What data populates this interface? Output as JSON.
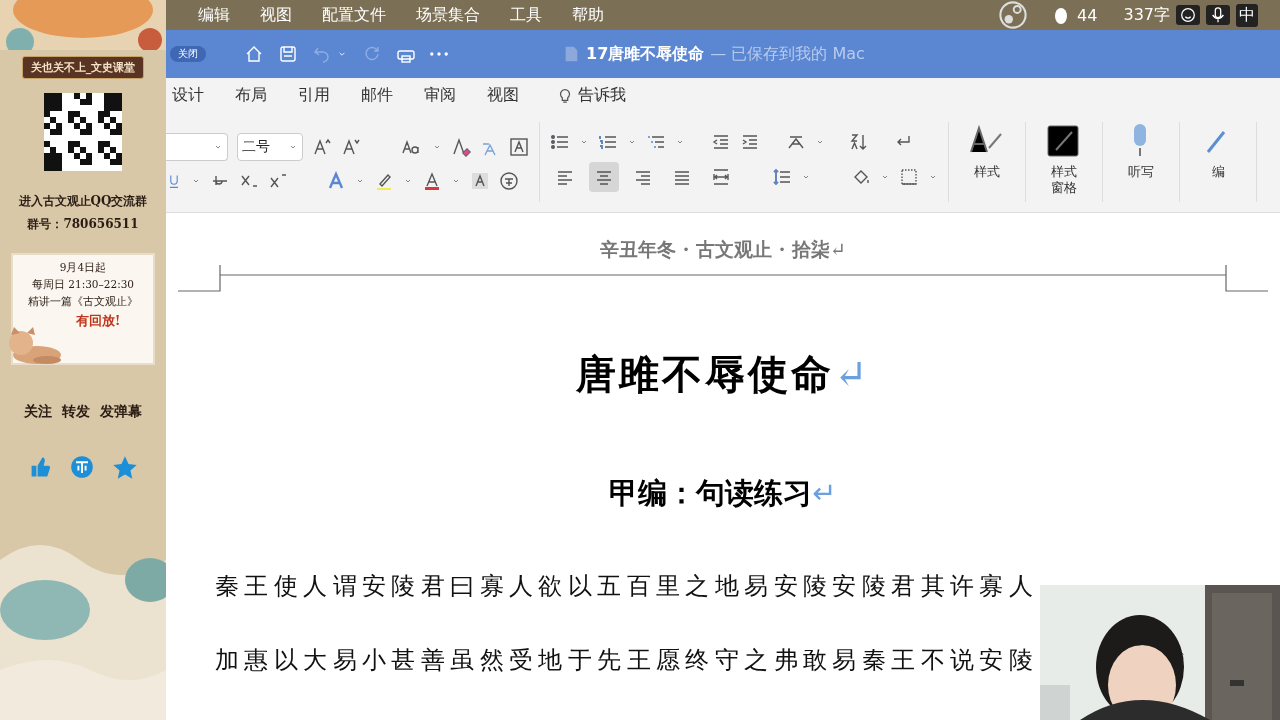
{
  "sidebar": {
    "channel_name": "关也关不上_文史课堂",
    "group_invite": "进入古文观止QQ交流群",
    "group_number": "群号：780656511",
    "schedule": {
      "lines": [
        "9月4日起",
        "每周日 21:30–22:30",
        "精讲一篇《古文观止》"
      ],
      "replay": "有回放!"
    },
    "actions": "关注  转发  发弹幕"
  },
  "menu_bar": {
    "items": [
      "编辑",
      "视图",
      "配置文件",
      "场景集合",
      "工具",
      "帮助"
    ],
    "notification_count": "44",
    "word_count": "337字",
    "input_method": "中"
  },
  "title_bar": {
    "close_label": "关闭",
    "doc_title": "17唐雎不辱使命",
    "save_status": "— 已保存到我的 Mac"
  },
  "ribbon_tabs": [
    {
      "label": "设计",
      "selected": false
    },
    {
      "label": "布局",
      "selected": false
    },
    {
      "label": "引用",
      "selected": false
    },
    {
      "label": "邮件",
      "selected": false
    },
    {
      "label": "审阅",
      "selected": false
    },
    {
      "label": "视图",
      "selected": false
    }
  ],
  "tell_me": "告诉我",
  "font_size": "二号",
  "alignment": [
    {
      "kind": "left",
      "selected": false
    },
    {
      "kind": "center",
      "selected": true
    },
    {
      "kind": "right",
      "selected": false
    },
    {
      "kind": "justify",
      "selected": false
    },
    {
      "kind": "distributed",
      "selected": false
    }
  ],
  "big_buttons": [
    {
      "kind": "styles",
      "label": "样式"
    },
    {
      "kind": "styles-pane",
      "label": "样式窗格"
    },
    {
      "kind": "dictate",
      "label": "听写"
    },
    {
      "kind": "edit",
      "label": "编"
    }
  ],
  "document": {
    "header": "辛丑年冬 · 古文观止 · 拾柒",
    "header_mark": "↵",
    "title": "唐雎不辱使命",
    "title_mark": "↵",
    "subtitle": "甲编：句读练习",
    "subtitle_mark": "↵",
    "lines": [
      "秦王使人谓安陵君曰寡人欲以五百里之地易安陵安陵君其许寡人",
      "加惠以大易小甚善虽然受地于先王愿终守之弗敢易秦王不说安陵"
    ]
  }
}
